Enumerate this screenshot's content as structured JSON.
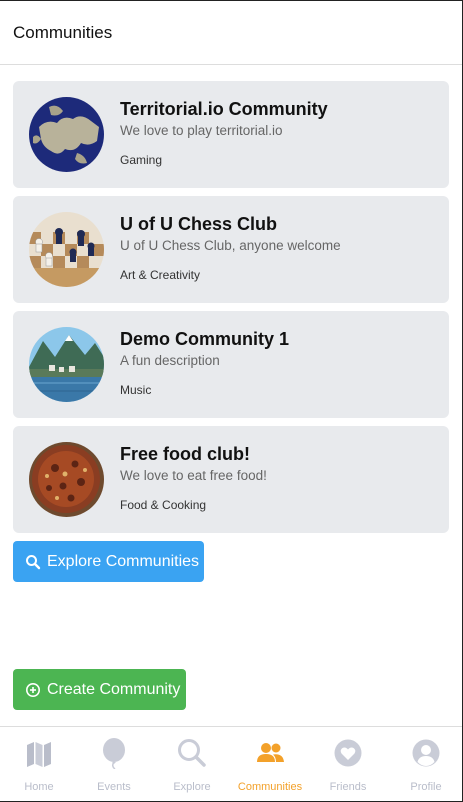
{
  "header": {
    "title": "Communities"
  },
  "communities": [
    {
      "name": "Territorial.io Community",
      "description": "We love to play territorial.io",
      "category": "Gaming",
      "avatar_icon": "europe-map-image"
    },
    {
      "name": "U of U Chess Club",
      "description": "U of U Chess Club, anyone welcome",
      "category": "Art & Creativity",
      "avatar_icon": "chessboard-image"
    },
    {
      "name": "Demo Community 1",
      "description": "A fun description",
      "category": "Music",
      "avatar_icon": "lakeside-village-image"
    },
    {
      "name": "Free food club!",
      "description": "We love to eat free food!",
      "category": "Food & Cooking",
      "avatar_icon": "pizza-image"
    }
  ],
  "actions": {
    "explore_label": "Explore Communities",
    "create_label": "Create Community"
  },
  "tabs": [
    {
      "label": "Home",
      "icon": "map-icon",
      "active": false
    },
    {
      "label": "Events",
      "icon": "balloon-icon",
      "active": false
    },
    {
      "label": "Explore",
      "icon": "search-icon",
      "active": false
    },
    {
      "label": "Communities",
      "icon": "users-icon",
      "active": true
    },
    {
      "label": "Friends",
      "icon": "heart-icon",
      "active": false
    },
    {
      "label": "Profile",
      "icon": "profile-icon",
      "active": false
    }
  ],
  "colors": {
    "accent": "#f3a12a",
    "explore_button": "#3aa3f2",
    "create_button": "#4cb552",
    "card_bg": "#e8eaed",
    "inactive_tab": "#b9bdca"
  }
}
